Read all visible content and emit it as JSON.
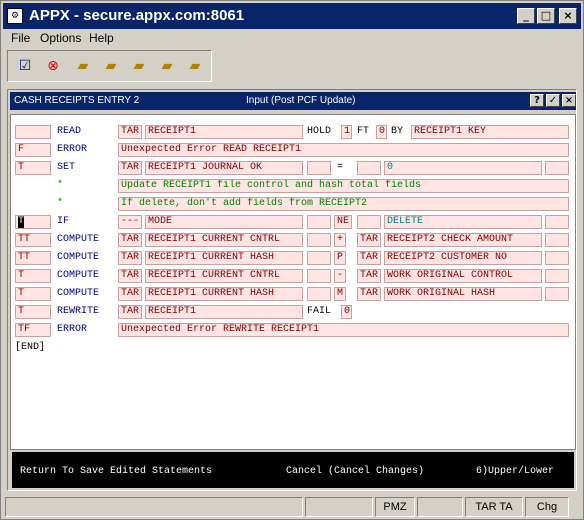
{
  "window": {
    "title": "APPX - secure.appx.com:8061",
    "app_icon": "appx-icon"
  },
  "menu": [
    "File",
    "Options",
    "Help"
  ],
  "toolbar": [
    "check-icon",
    "cancel-icon",
    "folder-new-icon",
    "folder-up-icon",
    "folder-search-icon",
    "folder-open-icon",
    "folder-delete-icon"
  ],
  "panel": {
    "left_title": "CASH RECEIPTS ENTRY 2",
    "mid_title": "Input  (Post PCF Update)",
    "help": "?",
    "ok": "✓",
    "close": "×"
  },
  "rows": [
    {
      "flag": "",
      "kw": "READ",
      "c1": "TAR",
      "c2": "RECEIPT1",
      "extra1": "HOLD",
      "extra2": "1",
      "extra3": "FT",
      "extra4": "0",
      "extra5": "BY",
      "c5": "RECEIPT1 KEY"
    },
    {
      "flag": "F",
      "kw": "ERROR",
      "wide": "Unexpected Error READ RECEIPT1"
    },
    {
      "flag": "T",
      "kw": "SET",
      "c1": "TAR",
      "c2": "RECEIPT1 JOURNAL OK",
      "c3": "",
      "op": "=",
      "c4": "",
      "c5": "0",
      "c6": ""
    },
    {
      "star": "*",
      "comment": "Update RECEIPT1 file control and hash total fields"
    },
    {
      "star": "*",
      "comment": "If delete, don't add fields from RECEIPT2"
    },
    {
      "flag": "T",
      "kw": "IF",
      "c1": "---",
      "c2": "MODE",
      "c3": "",
      "op": "NE",
      "c4": "",
      "c5": "DELETE",
      "c6": ""
    },
    {
      "flag": "TT",
      "kw": "COMPUTE",
      "c1": "TAR",
      "c2": "RECEIPT1 CURRENT CNTRL",
      "c3": "",
      "op": "+",
      "c4": "TAR",
      "c5": "RECEIPT2 CHECK AMOUNT",
      "c6": ""
    },
    {
      "flag": "TT",
      "kw": "COMPUTE",
      "c1": "TAR",
      "c2": "RECEIPT1 CURRENT HASH",
      "c3": "",
      "op": "P",
      "c4": "TAR",
      "c5": "RECEIPT2 CUSTOMER NO",
      "c6": ""
    },
    {
      "flag": "T",
      "kw": "COMPUTE",
      "c1": "TAR",
      "c2": "RECEIPT1 CURRENT CNTRL",
      "c3": "",
      "op": "-",
      "c4": "TAR",
      "c5": "WORK ORIGINAL CONTROL",
      "c6": ""
    },
    {
      "flag": "T",
      "kw": "COMPUTE",
      "c1": "TAR",
      "c2": "RECEIPT1 CURRENT HASH",
      "c3": "",
      "op": "M",
      "c4": "TAR",
      "c5": "WORK ORIGINAL HASH",
      "c6": ""
    },
    {
      "flag": "T",
      "kw": "REWRITE",
      "c1": "TAR",
      "c2": "RECEIPT1",
      "extra1": "FAIL",
      "extra2": "0"
    },
    {
      "flag": "TF",
      "kw": "ERROR",
      "wide": "Unexpected Error REWRITE RECEIPT1"
    }
  ],
  "end": "[END]",
  "hint": {
    "left": "Return To Save Edited Statements",
    "mid": "Cancel (Cancel Changes)",
    "right": "6)Upper/Lower"
  },
  "status": [
    "",
    "",
    "PMZ",
    "",
    "TAR TA",
    "Chg"
  ]
}
